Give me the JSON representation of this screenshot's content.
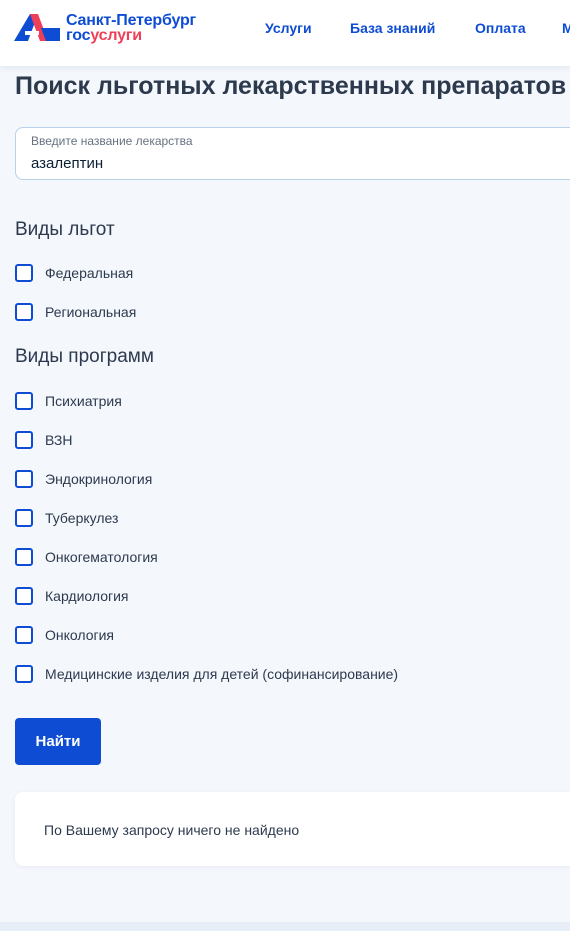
{
  "header": {
    "logo_line1": "Санкт-Петербург",
    "logo_gos": "гос",
    "logo_uslugi": "услуги",
    "nav": [
      {
        "label": "Услуги"
      },
      {
        "label": "База знаний"
      },
      {
        "label": "Оплата"
      },
      {
        "label": "М"
      }
    ]
  },
  "page_title": "Поиск льготных лекарственных препаратов",
  "search": {
    "label": "Введите название лекарства",
    "value": "азалептин"
  },
  "benefits": {
    "title": "Виды льгот",
    "items": [
      {
        "label": "Федеральная",
        "checked": false
      },
      {
        "label": "Региональная",
        "checked": false
      }
    ]
  },
  "programs": {
    "title": "Виды программ",
    "items": [
      {
        "label": "Психиатрия",
        "checked": false
      },
      {
        "label": "ВЗН",
        "checked": false
      },
      {
        "label": "Эндокринология",
        "checked": false
      },
      {
        "label": "Туберкулез",
        "checked": false
      },
      {
        "label": "Онкогематология",
        "checked": false
      },
      {
        "label": "Кардиология",
        "checked": false
      },
      {
        "label": "Онкология",
        "checked": false
      },
      {
        "label": "Медицинские изделия для детей (софинансирование)",
        "checked": false
      }
    ]
  },
  "find_button": "Найти",
  "result": {
    "message": "По Вашему запросу ничего не найдено"
  },
  "colors": {
    "primary": "#0d4cd3",
    "accent_red": "#ee3f58",
    "background": "#f4f7fc"
  }
}
